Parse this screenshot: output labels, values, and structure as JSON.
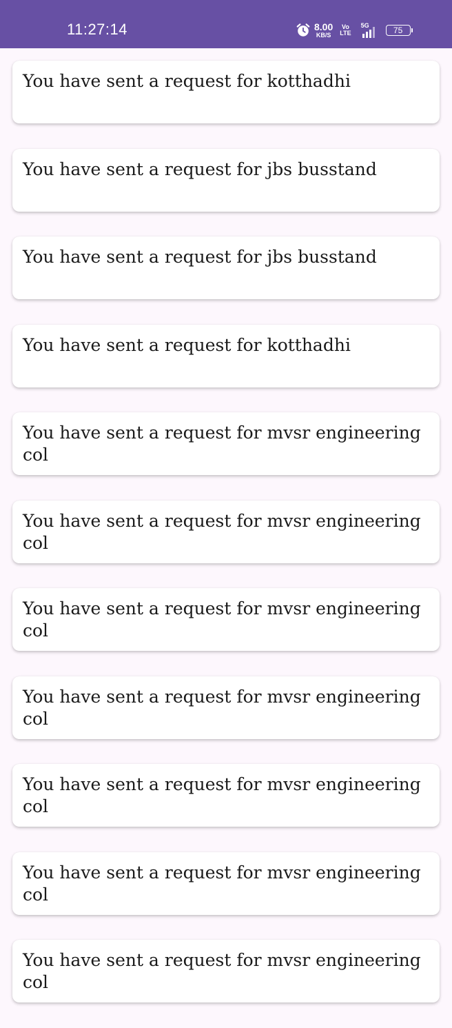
{
  "status_bar": {
    "time": "11:27:14",
    "icons": [
      "alarm-icon",
      "volte-icon",
      "signal-5g-icon",
      "battery-icon"
    ],
    "net_speed_value": "8.00",
    "net_speed_unit": "KB/S",
    "volte_top": "Vo",
    "volte_bottom": "LTE",
    "network": "5G",
    "battery": "75",
    "color": "#6750a4"
  },
  "background_color": "#fdf7fd",
  "requests": [
    "You have sent a request for kotthadhi",
    "You have sent a request for jbs busstand",
    "You have sent a request for jbs busstand",
    "You have sent a request for kotthadhi",
    "You have sent a request for mvsr engineering col",
    "You have sent a request for mvsr engineering col",
    "You have sent a request for mvsr engineering col",
    "You have sent a request for mvsr engineering col",
    "You have sent a request for mvsr engineering col",
    "You have sent a request for mvsr engineering col",
    "You have sent a request for mvsr engineering col"
  ]
}
